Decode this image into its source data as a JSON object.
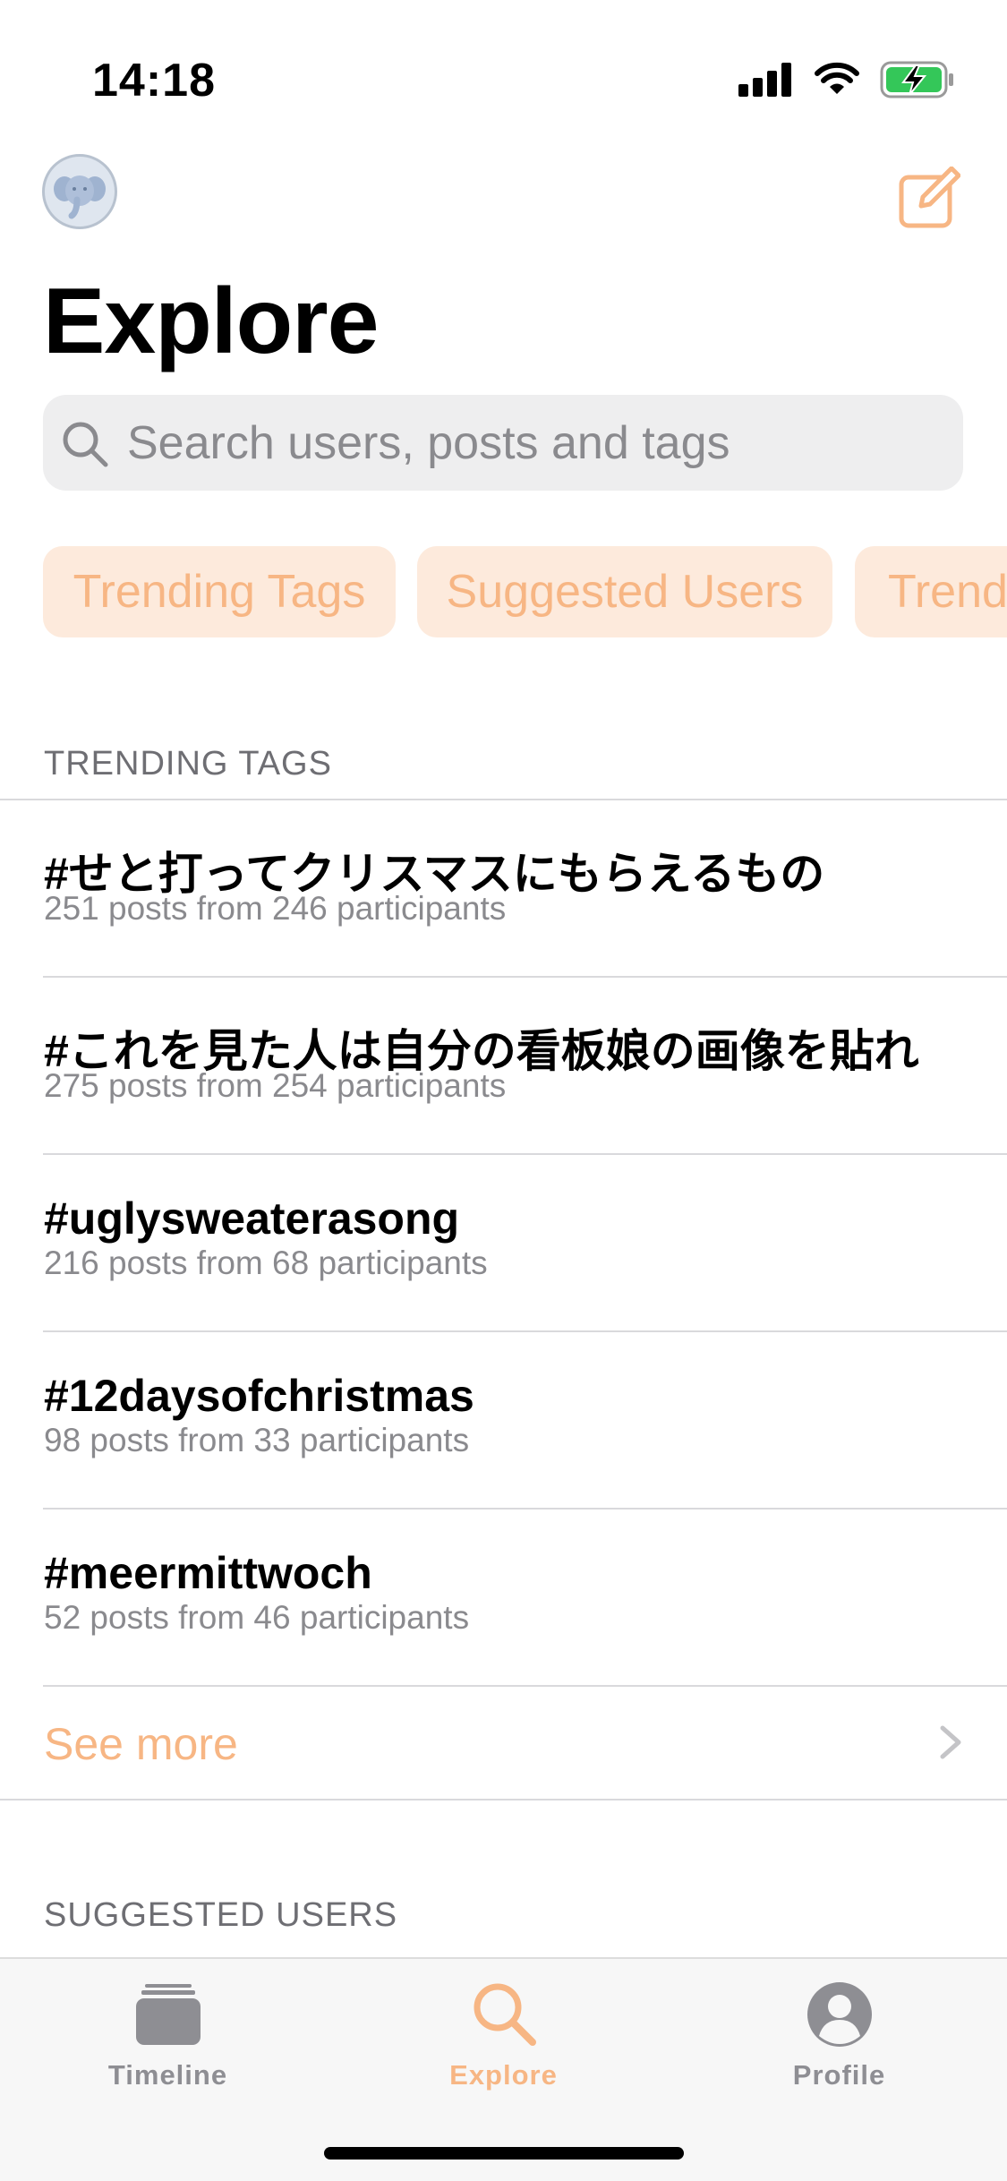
{
  "status_bar": {
    "time": "14:18"
  },
  "header": {
    "title": "Explore"
  },
  "search": {
    "placeholder": "Search users, posts and tags"
  },
  "chips": [
    {
      "label": "Trending Tags"
    },
    {
      "label": "Suggested Users"
    },
    {
      "label": "Trend"
    }
  ],
  "trending_tags": {
    "header": "TRENDING TAGS",
    "items": [
      {
        "tag": "#せと打ってクリスマスにもらえるもの",
        "stats": "251 posts from 246 participants"
      },
      {
        "tag": "#これを見た人は自分の看板娘の画像を貼れ",
        "stats": "275 posts from 254 participants"
      },
      {
        "tag": "#uglysweaterasong",
        "stats": "216 posts from 68 participants"
      },
      {
        "tag": "#12daysofchristmas",
        "stats": "98 posts from 33 participants"
      },
      {
        "tag": "#meermittwoch",
        "stats": "52 posts from 46 participants"
      }
    ],
    "see_more": "See more"
  },
  "suggested_users": {
    "header": "SUGGESTED USERS"
  },
  "tab_bar": {
    "tabs": [
      {
        "label": "Timeline",
        "icon": "stack-icon",
        "active": false
      },
      {
        "label": "Explore",
        "icon": "search-icon",
        "active": true
      },
      {
        "label": "Profile",
        "icon": "person-circle-icon",
        "active": false
      }
    ]
  },
  "colors": {
    "accent": "#f7b684",
    "chip_bg": "#fdeadc",
    "inactive_tab": "#8e8e93"
  }
}
